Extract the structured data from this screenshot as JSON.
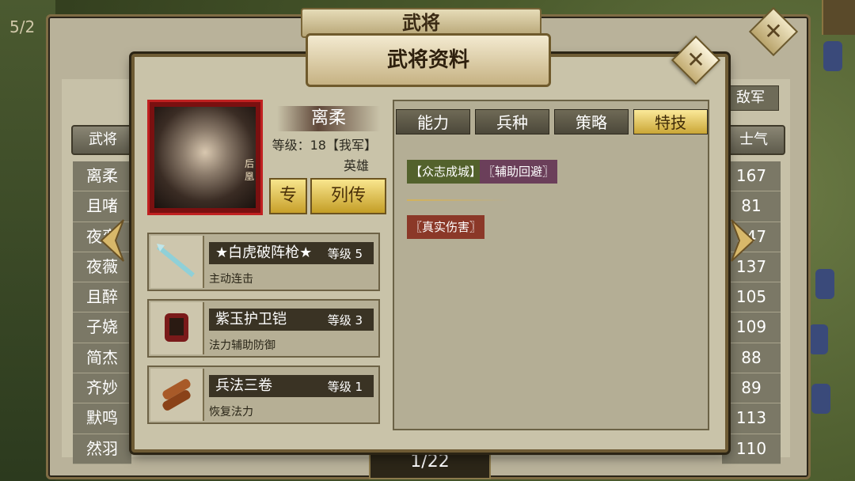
{
  "background": {
    "top_left_text": "5/2",
    "back_panel_title": "武将"
  },
  "back_table": {
    "header_left": "武将",
    "header_right": "士气",
    "header_army": "敌军",
    "names": [
      "离柔",
      "且啫",
      "夜蛮",
      "夜薇",
      "且醉",
      "子娆",
      "简杰",
      "齐妙",
      "默鸣",
      "然羽"
    ],
    "morale": [
      "167",
      "81",
      "147",
      "137",
      "105",
      "109",
      "88",
      "89",
      "113",
      "110"
    ],
    "pager": "1/22"
  },
  "dialog": {
    "title": "武将资料",
    "hero": {
      "name": "离柔",
      "level": "等级：18【我军】",
      "type": "英雄",
      "portrait_tag": "后凰"
    },
    "buttons": {
      "specialty": "专",
      "biography": "列传"
    },
    "equipment": [
      {
        "name": "★白虎破阵枪★",
        "level": "等级 5",
        "desc": "主动连击",
        "icon": "spear-icon"
      },
      {
        "name": "紫玉护卫铠",
        "level": "等级 3",
        "desc": "法力辅助防御",
        "icon": "armor-icon"
      },
      {
        "name": "兵法三卷",
        "level": "等级 1",
        "desc": "恢复法力",
        "icon": "scroll-icon"
      }
    ],
    "tabs": [
      "能力",
      "兵种",
      "策略",
      "特技"
    ],
    "active_tab": "特技",
    "skills": {
      "green": "【众志成城】",
      "purple": "〖辅助回避〗",
      "red": "〖真实伤害〗"
    }
  },
  "colors": {
    "gold": "#caa636",
    "panel": "#c9c3a9",
    "dark": "#3a3324"
  }
}
